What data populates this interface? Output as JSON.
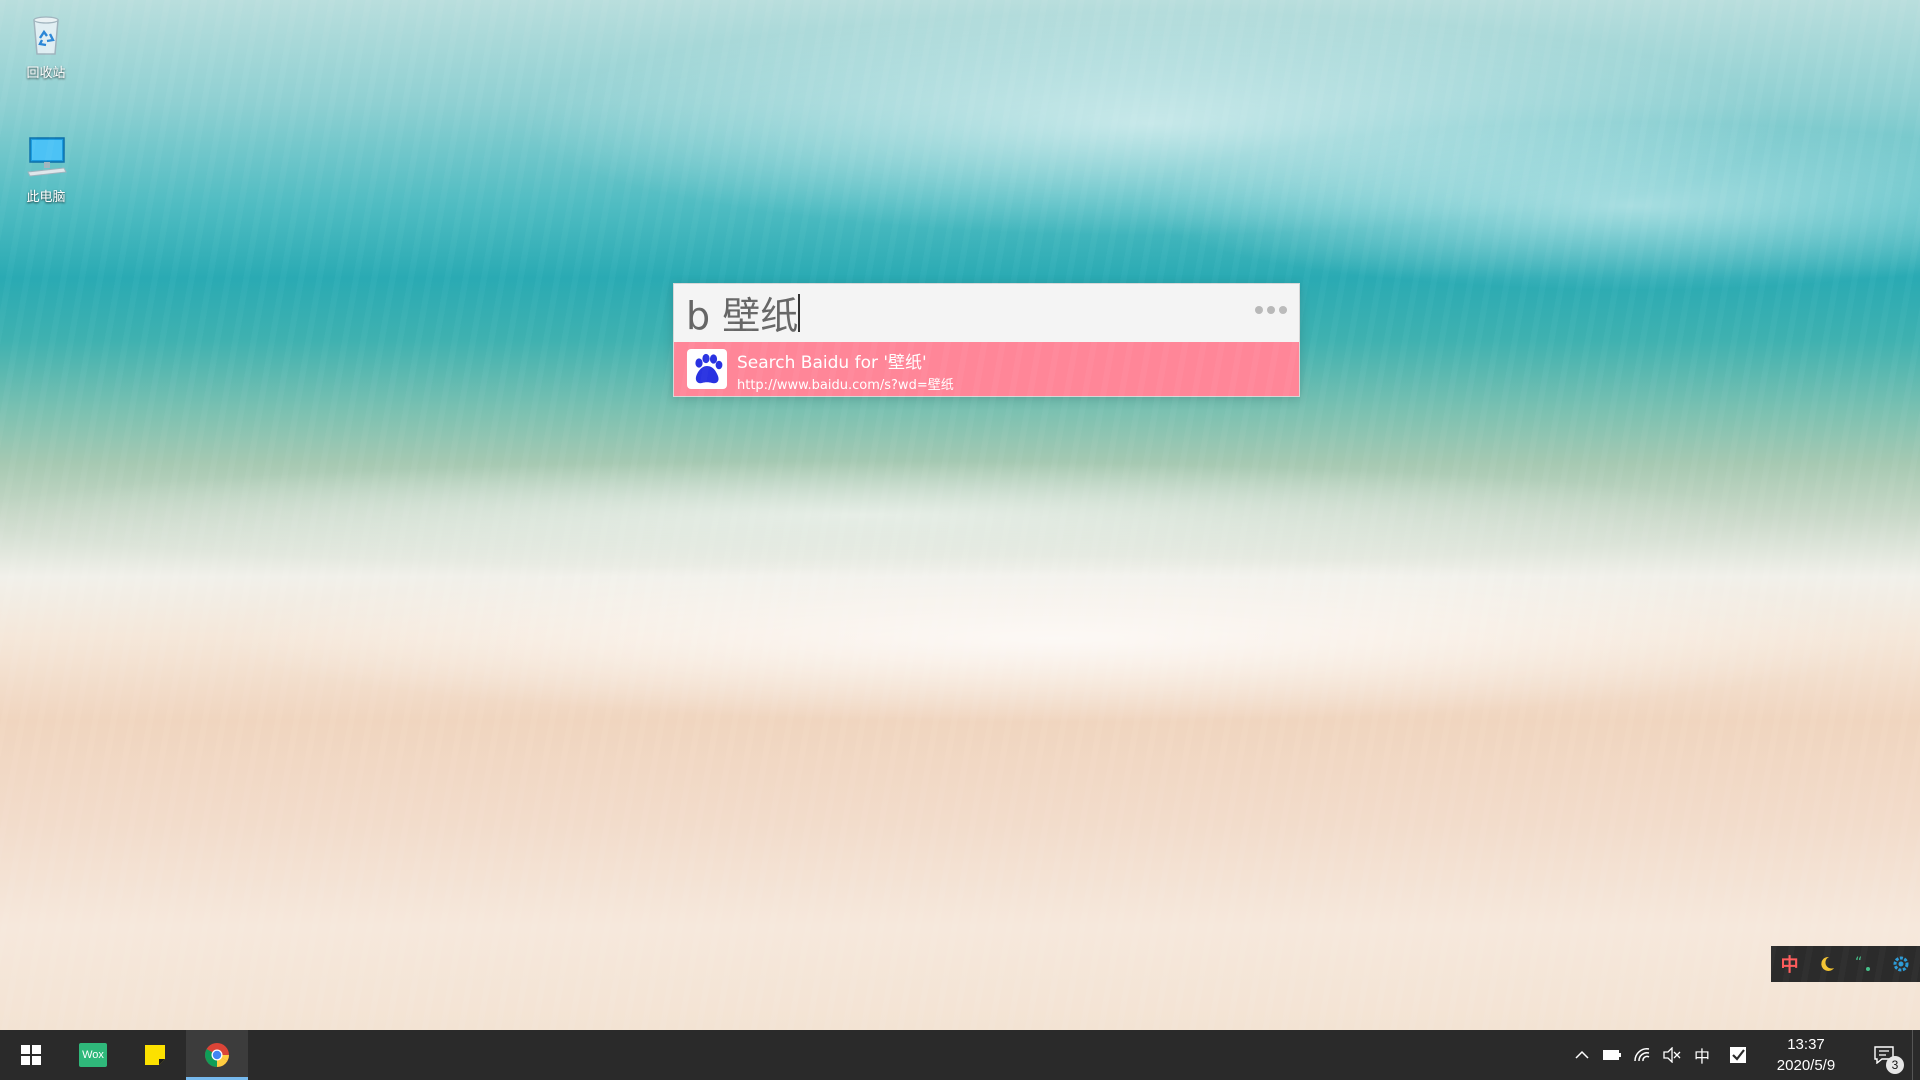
{
  "desktop": {
    "icons": [
      {
        "label": "回收站",
        "icon": "recycle-bin-icon"
      },
      {
        "label": "此电脑",
        "icon": "this-pc-icon"
      }
    ]
  },
  "wox": {
    "query": "b 壁纸",
    "menu_icon": "more-dots-icon",
    "results": [
      {
        "title": "Search Baidu for '壁纸'",
        "subtitle": "http://www.baidu.com/s?wd=壁纸",
        "icon": "baidu-paw-icon",
        "selected": true
      }
    ],
    "colors": {
      "selected_bg": "#ff8698",
      "query_bg": "#f4f4f4"
    }
  },
  "ime_toolbar": {
    "mode_label": "中",
    "buttons": [
      "chinese-mode",
      "half-width-moon-icon",
      "punctuation-icon",
      "ime-settings-icon"
    ]
  },
  "taskbar": {
    "apps": [
      {
        "name": "start",
        "icon": "windows-logo-icon"
      },
      {
        "name": "wox",
        "label": "Wox",
        "icon": "wox-icon"
      },
      {
        "name": "sticky-notes",
        "icon": "sticky-notes-icon"
      },
      {
        "name": "chrome",
        "icon": "chrome-icon",
        "active": true
      }
    ],
    "tray": {
      "ime_label": "中",
      "icons": [
        "show-hidden-chevron-icon",
        "battery-icon",
        "wifi-icon",
        "volume-muted-icon",
        "ime-indicator",
        "checkbox-app-icon"
      ]
    },
    "clock": {
      "time": "13:37",
      "date": "2020/5/9"
    },
    "notifications": {
      "count": "3"
    }
  }
}
